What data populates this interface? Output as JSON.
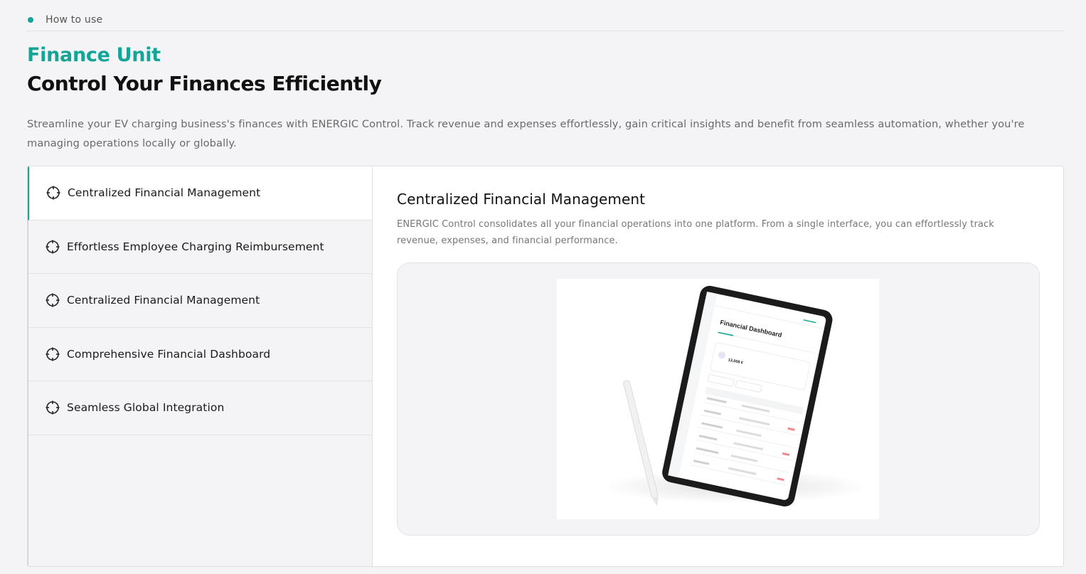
{
  "breadcrumb": {
    "label": "How to use"
  },
  "header": {
    "eyebrow": "Finance Unit",
    "title": "Control Your Finances Efficiently",
    "intro": "Streamline your EV charging business's finances with ENERGIC Control. Track revenue and expenses effortlessly, gain critical insights and benefit from seamless automation, whether you're managing operations locally or globally."
  },
  "sidebar": {
    "items": [
      {
        "label": "Centralized Financial Management",
        "active": true,
        "icon": "crosshair-icon"
      },
      {
        "label": "Effortless Employee Charging Reimbursement",
        "active": false,
        "icon": "crosshair-icon"
      },
      {
        "label": "Centralized Financial Management",
        "active": false,
        "icon": "crosshair-icon"
      },
      {
        "label": "Comprehensive Financial Dashboard",
        "active": false,
        "icon": "crosshair-icon"
      },
      {
        "label": "Seamless Global Integration",
        "active": false,
        "icon": "crosshair-icon"
      }
    ]
  },
  "detail": {
    "title": "Centralized Financial Management",
    "description": "ENERGIC Control consolidates all your financial operations into one platform. From a single interface, you can effortlessly track revenue, expenses, and financial performance.",
    "image": {
      "screen_title": "Financial Dashboard",
      "amount": "13,008 €"
    }
  },
  "colors": {
    "accent": "#14a597",
    "text": "#111111",
    "muted": "#6a6a6a",
    "background": "#f4f4f6"
  }
}
